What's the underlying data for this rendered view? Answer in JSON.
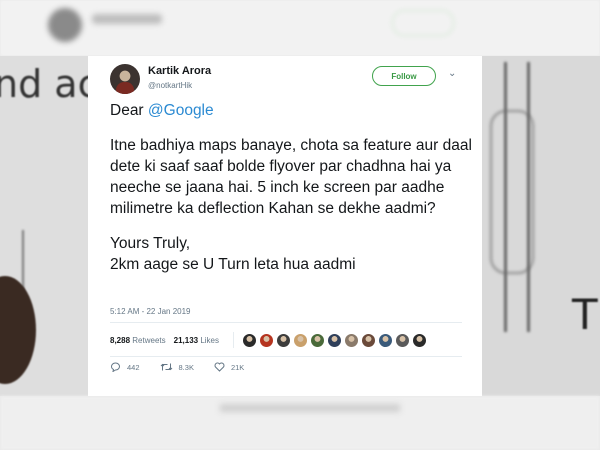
{
  "background": {
    "left_text": "nd ac",
    "right_letter": "T"
  },
  "tweet": {
    "author": {
      "name": "Kartik Arora",
      "handle": "@notkartHik"
    },
    "follow_label": "Follow",
    "text": {
      "greeting_prefix": "Dear ",
      "mention": "@Google",
      "body": "Itne badhiya maps banaye, chota sa feature aur daal dete ki saaf saaf bolde flyover par chadhna hai ya neeche se jaana hai. 5 inch ke screen par aadhe milimetre ka deflection Kahan se dekhe aadmi?",
      "signoff_line1": "Yours Truly,",
      "signoff_line2": "2km aage se U Turn leta hua aadmi"
    },
    "timestamp": "5:12 AM - 22 Jan 2019",
    "stats": {
      "retweets_count": "8,288",
      "retweets_label": "Retweets",
      "likes_count": "21,133",
      "likes_label": "Likes"
    },
    "liker_avatar_colors": [
      "#2a2a2a",
      "#b5341f",
      "#3c3c3c",
      "#c9a06b",
      "#4a6a3a",
      "#2f3f5a",
      "#8a7a6a",
      "#6a4a3a",
      "#3a5a7a",
      "#5a5a5a",
      "#2a2a2a"
    ],
    "actions": {
      "reply_count": "442",
      "retweet_count": "8.3K",
      "like_count": "21K"
    },
    "icons": {
      "avatar": "profile-photo",
      "menu": "chevron-down-icon",
      "reply": "reply-icon",
      "retweet": "retweet-icon",
      "like": "heart-icon"
    },
    "colors": {
      "mention": "#2b8ad2",
      "follow": "#41a34d"
    }
  }
}
